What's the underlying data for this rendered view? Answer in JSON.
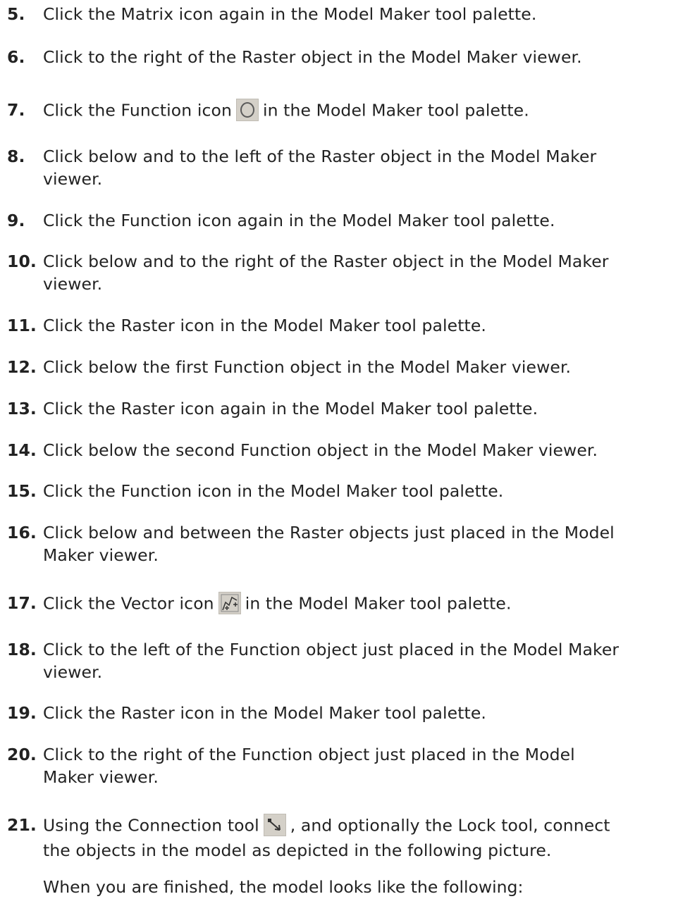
{
  "steps": [
    {
      "num": "5.",
      "text": "Click the Matrix icon again in the Model Maker tool palette."
    },
    {
      "num": "6.",
      "text": "Click to the right of the Raster object in the Model Maker viewer."
    },
    {
      "num": "7.",
      "text_a": "Click the Function icon",
      "text_b": "in the Model Maker tool palette.",
      "icon": "function-icon"
    },
    {
      "num": "8.",
      "line1": "Click below and to the left of the Raster object in the Model Maker",
      "line2": "viewer."
    },
    {
      "num": "9.",
      "text": "Click the Function icon again in the Model Maker tool palette."
    },
    {
      "num": "10.",
      "line1": "Click below and to the right of the Raster object in the Model Maker",
      "line2": "viewer."
    },
    {
      "num": "11.",
      "text": "Click the Raster icon in the Model Maker tool palette."
    },
    {
      "num": "12.",
      "text": "Click below the first Function object in the Model Maker viewer."
    },
    {
      "num": "13.",
      "text": "Click the Raster icon again in the Model Maker tool palette."
    },
    {
      "num": "14.",
      "text": "Click below the second Function object in the Model Maker viewer."
    },
    {
      "num": "15.",
      "text": "Click the Function icon in the Model Maker tool palette."
    },
    {
      "num": "16.",
      "line1": "Click below and between the Raster objects just placed in the Model",
      "line2": "Maker viewer."
    },
    {
      "num": "17.",
      "text_a": "Click the Vector icon",
      "text_b": "in the Model Maker tool palette.",
      "icon": "vector-icon"
    },
    {
      "num": "18.",
      "line1": "Click to the left of the Function object just placed in the Model Maker",
      "line2": "viewer."
    },
    {
      "num": "19.",
      "text": "Click the Raster icon in the Model Maker tool palette."
    },
    {
      "num": "20.",
      "line1": "Click to the right of the Function object just placed in the Model",
      "line2": "Maker viewer."
    },
    {
      "num": "21.",
      "text_a": "Using the Connection tool",
      "text_b": ", and optionally the Lock tool, connect",
      "line2": "the objects in the model as depicted in the following picture.",
      "icon": "connection-icon"
    }
  ],
  "closing": "When you are finished, the model looks like the following:"
}
